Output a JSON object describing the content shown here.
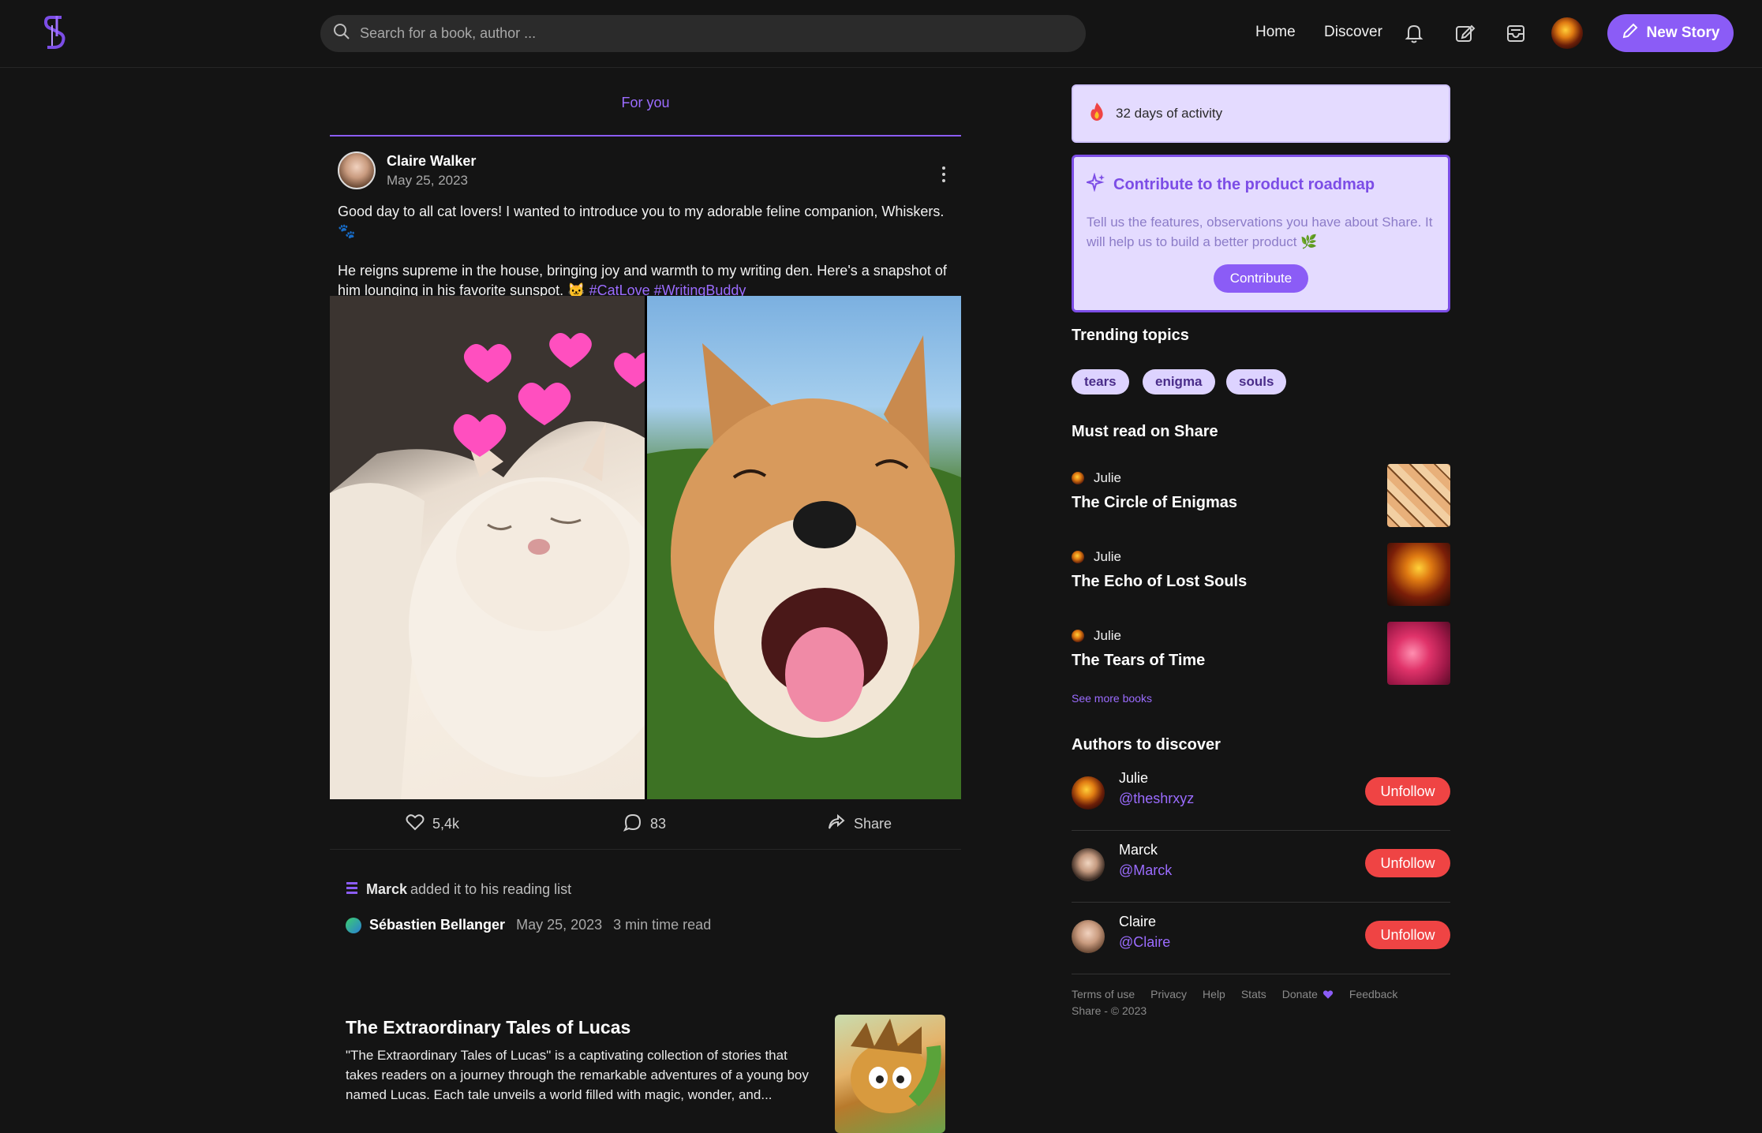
{
  "header": {
    "search_placeholder": "Search for a book, author ...",
    "nav": {
      "home": "Home",
      "discover": "Discover"
    },
    "new_story_label": "New Story",
    "accent": "#8b5cf6"
  },
  "feed": {
    "tab": "For you",
    "post": {
      "author": "Claire Walker",
      "date": "May 25, 2023",
      "text_1": "Good day to all cat lovers! I wanted to introduce you to my adorable feline companion, Whiskers. 🐾",
      "text_2": "He reigns supreme in the house, bringing joy and warmth to my writing den. Here's a snapshot of him lounging in his favorite sunspot. 🐱",
      "hashtag_1": "#CatLove",
      "hashtag_2": "#WritingBuddy",
      "likes": "5,4k",
      "comments": "83",
      "share_label": "Share"
    },
    "reading_list": {
      "user": "Marck",
      "text": "added it to his reading list"
    },
    "story": {
      "author": "Sébastien Bellanger",
      "date": "May 25, 2023",
      "read_time": "3 min time read",
      "title": "The Extraordinary Tales of Lucas",
      "excerpt": "\"The Extraordinary Tales of Lucas\" is a captivating collection of stories that takes readers on a journey through the remarkable adventures of a young boy named Lucas. Each tale unveils a world filled with magic, wonder, and..."
    }
  },
  "sidebar": {
    "streak": "32 days of activity",
    "roadmap": {
      "title": "Contribute to the product roadmap",
      "text": "Tell us the features, observations you have about Share. It will help us to build a better product 🌿",
      "button": "Contribute"
    },
    "trending_title": "Trending topics",
    "topics": [
      "tears",
      "enigma",
      "souls"
    ],
    "must_read_title": "Must read on Share",
    "books": [
      {
        "author": "Julie",
        "title": "The Circle of Enigmas"
      },
      {
        "author": "Julie",
        "title": "The Echo of Lost Souls"
      },
      {
        "author": "Julie",
        "title": "The Tears of Time"
      }
    ],
    "see_more": "See more books",
    "authors_title": "Authors to discover",
    "authors": [
      {
        "name": "Julie",
        "handle": "@theshrxyz",
        "button": "Unfollow"
      },
      {
        "name": "Marck",
        "handle": "@Marck",
        "button": "Unfollow"
      },
      {
        "name": "Claire",
        "handle": "@Claire",
        "button": "Unfollow"
      }
    ],
    "footer_links": [
      "Terms of use",
      "Privacy",
      "Help",
      "Stats",
      "Donate",
      "Feedback"
    ],
    "copyright": "Share - © 2023"
  }
}
